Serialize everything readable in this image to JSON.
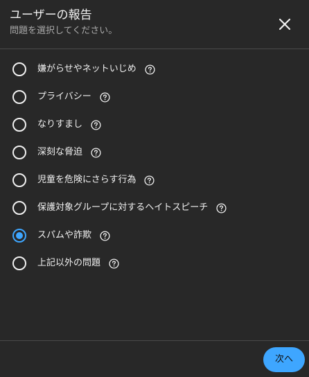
{
  "dialog": {
    "title": "ユーザーの報告",
    "subtitle": "問題を選択してください。",
    "close_icon": "close-icon"
  },
  "options": [
    {
      "label": "嫌がらせやネットいじめ",
      "selected": false,
      "help_icon": "help-icon"
    },
    {
      "label": "プライバシー",
      "selected": false,
      "help_icon": "help-icon"
    },
    {
      "label": "なりすまし",
      "selected": false,
      "help_icon": "help-icon"
    },
    {
      "label": "深刻な脅迫",
      "selected": false,
      "help_icon": "help-icon"
    },
    {
      "label": "児童を危険にさらす行為",
      "selected": false,
      "help_icon": "help-icon"
    },
    {
      "label": "保護対象グループに対するヘイトスピーチ",
      "selected": false,
      "help_icon": "help-icon"
    },
    {
      "label": "スパムや詐欺",
      "selected": true,
      "help_icon": "help-icon"
    },
    {
      "label": "上記以外の問題",
      "selected": false,
      "help_icon": "help-icon"
    }
  ],
  "footer": {
    "next_label": "次へ"
  },
  "colors": {
    "background": "#282828",
    "accent": "#3ea6ff",
    "text": "#f1f1f1",
    "subtext": "#aaaaaa",
    "divider": "#4a4a4a"
  }
}
